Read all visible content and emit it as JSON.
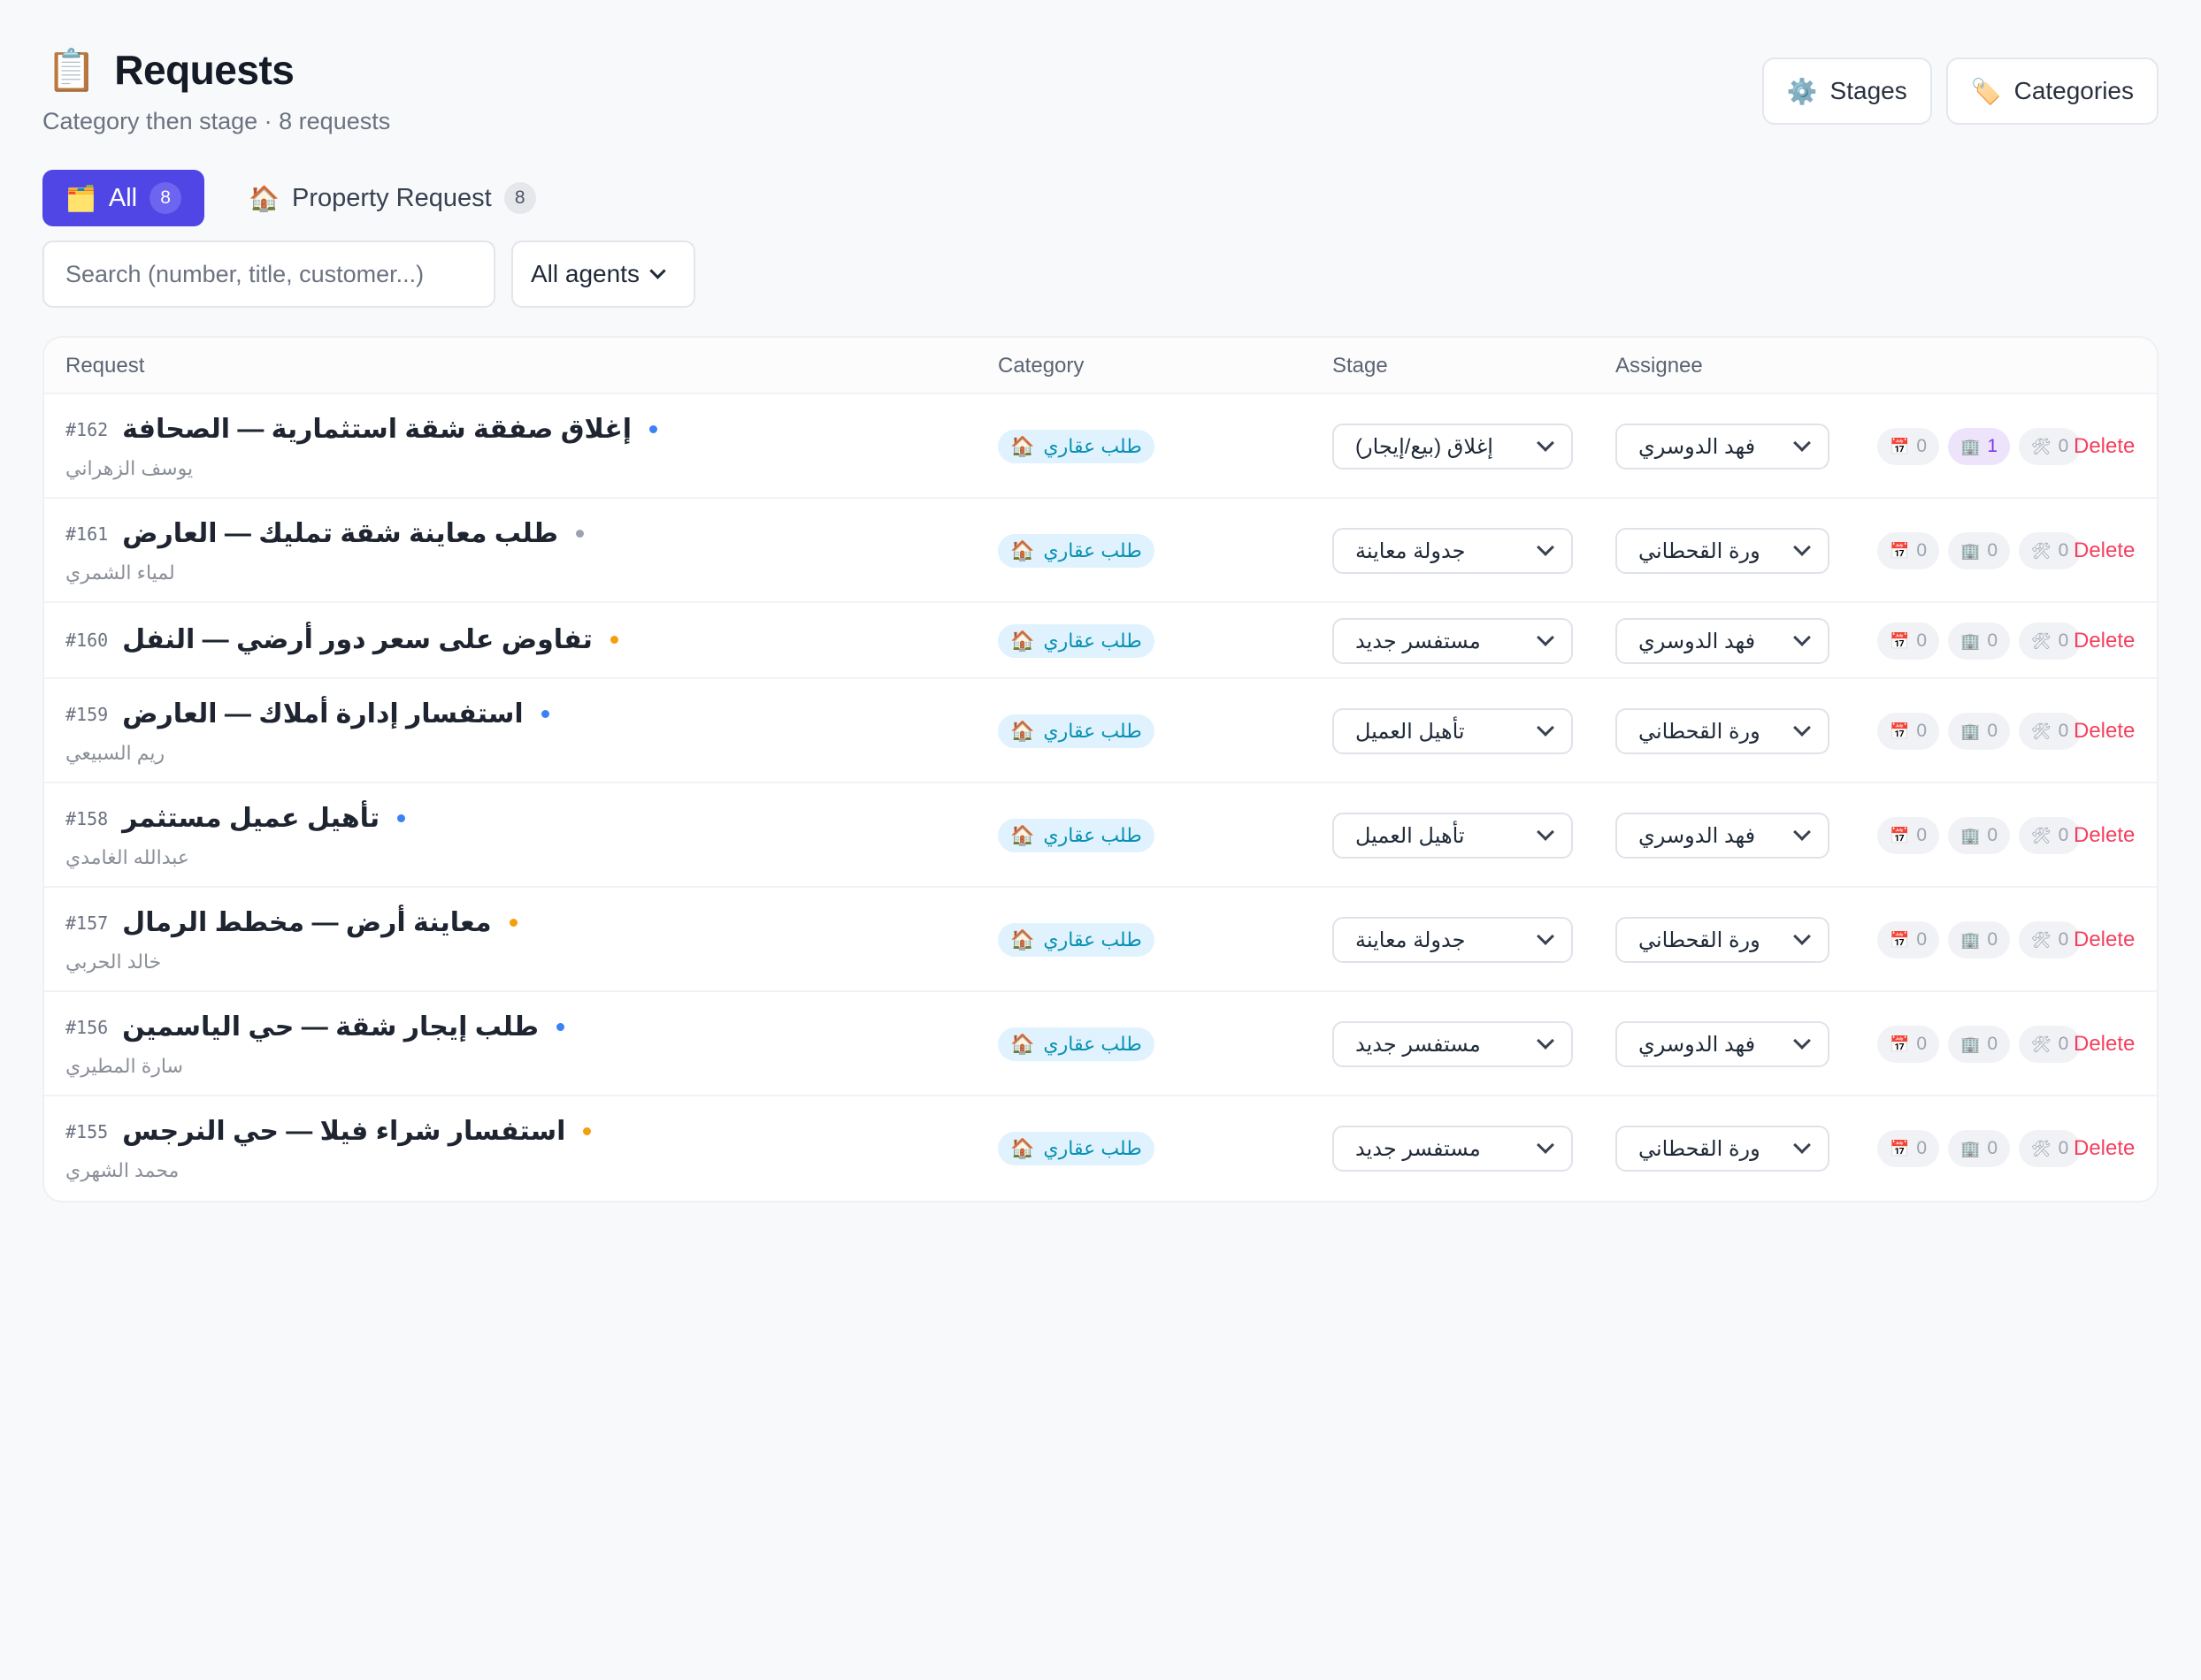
{
  "header": {
    "icon": "clipboard-icon",
    "title": "Requests",
    "subtitle": "Category then stage · 8 requests",
    "actions": [
      {
        "icon": "gear-icon",
        "glyph": "⚙️",
        "label": "Stages"
      },
      {
        "icon": "tag-icon",
        "glyph": "🏷️",
        "label": "Categories"
      }
    ]
  },
  "tabs": [
    {
      "icon": "folder-icon",
      "glyph": "🗂️",
      "label": "All",
      "count": "8",
      "active": true
    },
    {
      "icon": "house-icon",
      "glyph": "🏠",
      "label": "Property Request",
      "count": "8",
      "active": false
    }
  ],
  "filters": {
    "search_placeholder": "Search (number, title, customer...)",
    "agent_select": "All agents"
  },
  "table": {
    "columns": {
      "request": "Request",
      "category": "Category",
      "stage": "Stage",
      "assignee": "Assignee"
    },
    "delete_label": "Delete",
    "rows": [
      {
        "num": "#162",
        "title": "إغلاق صفقة شقة استثمارية — الصحافة",
        "dot": "#3b82f6",
        "customer": "يوسف الزهراني",
        "category": "طلب عقاري",
        "stage": "إغلاق (بيع/إيجار)",
        "assignee": "فهد الدوسري",
        "c1": "0",
        "c2": "1",
        "c3": "0",
        "c2_hot": true
      },
      {
        "num": "#161",
        "title": "طلب معاينة شقة تمليك — العارض",
        "dot": "#9ca3af",
        "customer": "لمياء الشمري",
        "category": "طلب عقاري",
        "stage": "جدولة معاينة",
        "assignee": "ورة القحطاني",
        "c1": "0",
        "c2": "0",
        "c3": "0"
      },
      {
        "num": "#160",
        "title": "تفاوض على سعر دور أرضي — النفل",
        "dot": "#f59e0b",
        "customer": "",
        "category": "طلب عقاري",
        "stage": "مستفسر جديد",
        "assignee": "فهد الدوسري",
        "c1": "0",
        "c2": "0",
        "c3": "0"
      },
      {
        "num": "#159",
        "title": "استفسار إدارة أملاك — العارض",
        "dot": "#3b82f6",
        "customer": "ريم السبيعي",
        "category": "طلب عقاري",
        "stage": "تأهيل العميل",
        "assignee": "ورة القحطاني",
        "c1": "0",
        "c2": "0",
        "c3": "0"
      },
      {
        "num": "#158",
        "title": "تأهيل عميل مستثمر",
        "dot": "#3b82f6",
        "customer": "عبدالله الغامدي",
        "category": "طلب عقاري",
        "stage": "تأهيل العميل",
        "assignee": "فهد الدوسري",
        "c1": "0",
        "c2": "0",
        "c3": "0"
      },
      {
        "num": "#157",
        "title": "معاينة أرض — مخطط الرمال",
        "dot": "#f59e0b",
        "customer": "خالد الحربي",
        "category": "طلب عقاري",
        "stage": "جدولة معاينة",
        "assignee": "ورة القحطاني",
        "c1": "0",
        "c2": "0",
        "c3": "0"
      },
      {
        "num": "#156",
        "title": "طلب إيجار شقة — حي الياسمين",
        "dot": "#3b82f6",
        "customer": "سارة المطيري",
        "category": "طلب عقاري",
        "stage": "مستفسر جديد",
        "assignee": "فهد الدوسري",
        "c1": "0",
        "c2": "0",
        "c3": "0"
      },
      {
        "num": "#155",
        "title": "استفسار شراء فيلا — حي النرجس",
        "dot": "#f59e0b",
        "customer": "محمد الشهري",
        "category": "طلب عقاري",
        "stage": "مستفسر جديد",
        "assignee": "ورة القحطاني",
        "c1": "0",
        "c2": "0",
        "c3": "0"
      }
    ],
    "pill_icons": [
      "calendar-icon",
      "building-icon",
      "tools-icon"
    ],
    "category_icon": "house-icon"
  }
}
